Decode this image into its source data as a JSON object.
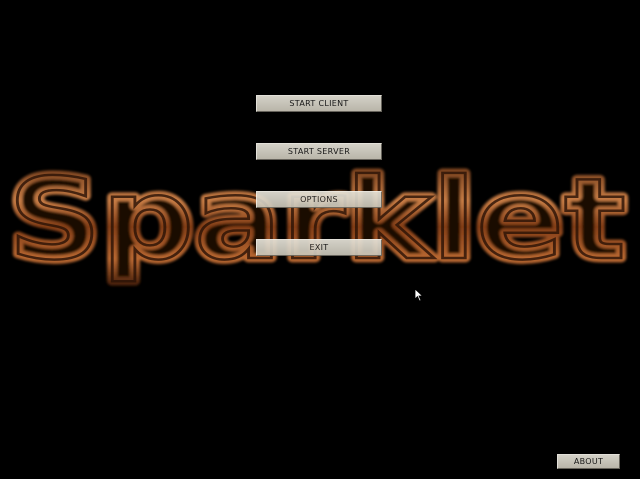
{
  "logo": {
    "text": "Sparklet",
    "color": "#b5652f"
  },
  "menu": {
    "start_client": "START CLIENT",
    "start_server": "START SERVER",
    "options": "OPTIONS",
    "exit": "EXIT"
  },
  "about_label": "ABOUT",
  "version_text": "",
  "credit_text": "",
  "colors": {
    "background": "#000000",
    "button_face": "#d8d5ca",
    "logo_copper": "#b5652f"
  }
}
